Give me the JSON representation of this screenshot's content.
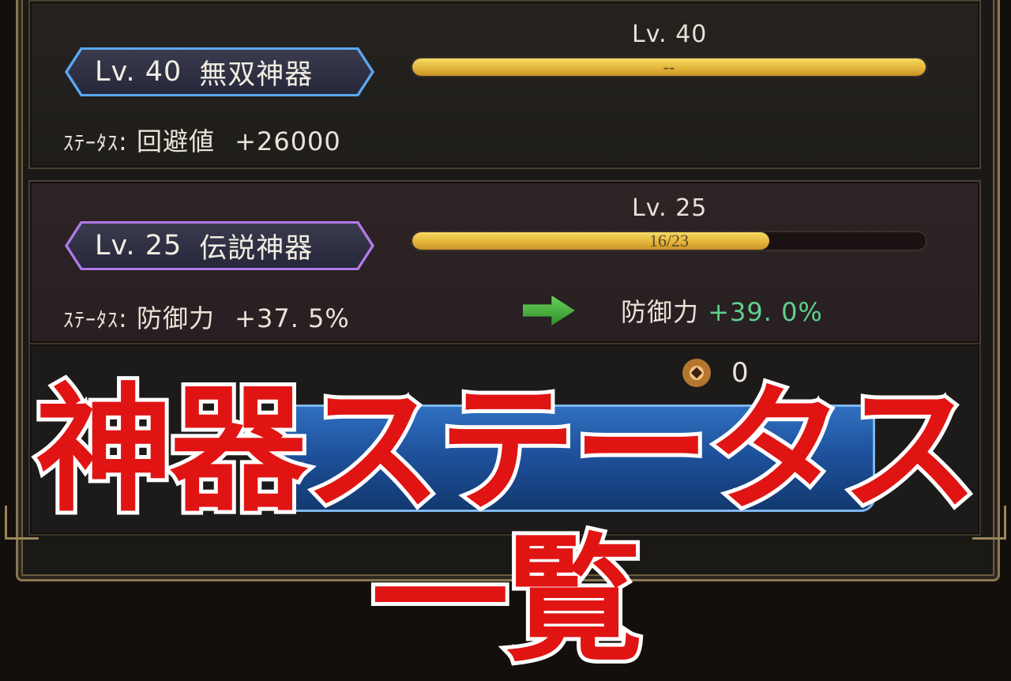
{
  "artifact_rows": [
    {
      "badge_level": "Lv. 40",
      "badge_name": "無双神器",
      "status_prefix": "ｽﾃｰﾀｽ",
      "status_stat": "回避値",
      "status_value": "+26000",
      "bar_level_label": "Lv. 40",
      "bar_text": "--",
      "bar_fill_fraction": 1.0
    },
    {
      "badge_level": "Lv. 25",
      "badge_name": "伝説神器",
      "status_prefix": "ｽﾃｰﾀｽ",
      "status_stat": "防御力",
      "status_value": "+37. 5%",
      "bar_level_label": "Lv. 25",
      "bar_text": "16/23",
      "bar_fill_fraction": 0.6957,
      "next_stat": "防御力",
      "next_value": "+39. 0%"
    }
  ],
  "currency": {
    "icon": "coin-icon",
    "amount": "0"
  },
  "banner_title": "神器ステータス一覧",
  "colors": {
    "banner_text": "#e11414",
    "banner_outline": "#ffffff",
    "next_value": "#5fd08c",
    "bar_fill": "#e8bc40",
    "badge_border_blue": "#5aa8f0",
    "badge_border_purple": "#b07ae6"
  }
}
